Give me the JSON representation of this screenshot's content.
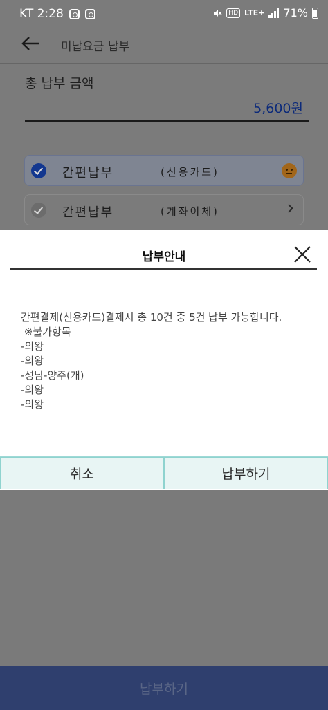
{
  "status_bar": {
    "carrier_time": "KT 2:28",
    "network_badge": "HD",
    "network_type": "LTE+",
    "battery": "71%"
  },
  "header": {
    "title": "미납요금 납부"
  },
  "total": {
    "label": "총 납부 금액",
    "amount": "5,600원"
  },
  "payment_options": [
    {
      "title": "간편납부",
      "subtitle": "(신용카드)",
      "selected": true
    },
    {
      "title": "간편납부",
      "subtitle": "(계좌이체)",
      "selected": false
    }
  ],
  "dialog": {
    "title": "납부안내",
    "lines": [
      "간편결제(신용카드)결제시 총 10건 중 5건 납부 가능합니다.",
      " ※불가항목",
      "-의왕",
      "-의왕",
      "-성남-양주(개)",
      "-의왕",
      "-의왕"
    ],
    "cancel_label": "취소",
    "confirm_label": "납부하기"
  },
  "bottom_button": {
    "label": "납부하기"
  }
}
